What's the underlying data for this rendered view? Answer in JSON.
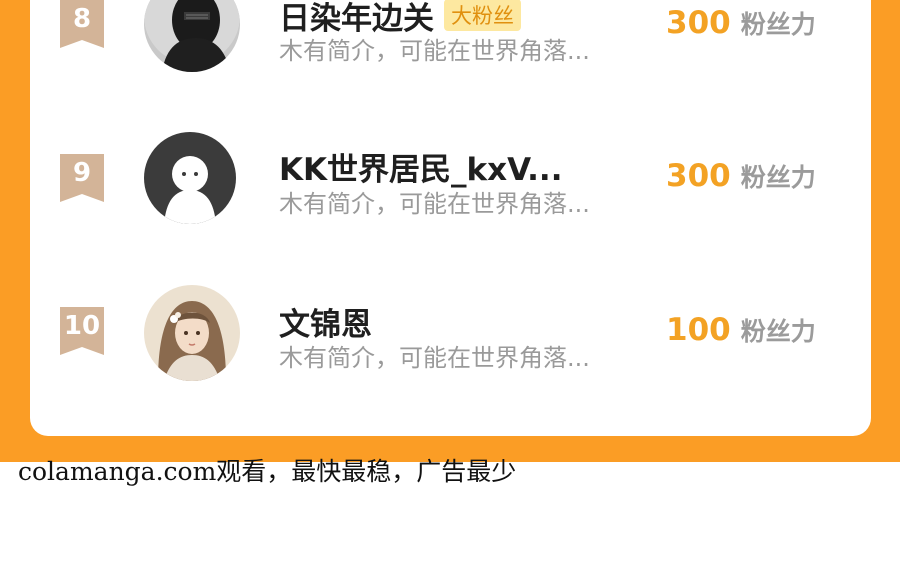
{
  "ranking": {
    "rows": [
      {
        "rank": "8",
        "name": "日染年边关",
        "badge": "大粉丝",
        "bio": "木有简介，可能在世界角落...",
        "score": "300",
        "score_unit": "粉丝力",
        "avatar": "photo-avatar-dark-figure"
      },
      {
        "rank": "9",
        "name": "KK世界居民_kxV...",
        "badge": "",
        "bio": "木有简介，可能在世界角落...",
        "score": "300",
        "score_unit": "粉丝力",
        "avatar": "default-ghost-avatar"
      },
      {
        "rank": "10",
        "name": "文锦恩",
        "badge": "",
        "bio": "木有简介，可能在世界角落...",
        "score": "100",
        "score_unit": "粉丝力",
        "avatar": "illustrated-girl-avatar"
      }
    ]
  },
  "watermark": "colamanga.com观看，最快最稳，广告最少",
  "colors": {
    "background_orange": "#fb9d25",
    "badge_tan": "#d3b498",
    "score_orange": "#f3a224",
    "fan_badge_bg": "#fde8a0"
  }
}
